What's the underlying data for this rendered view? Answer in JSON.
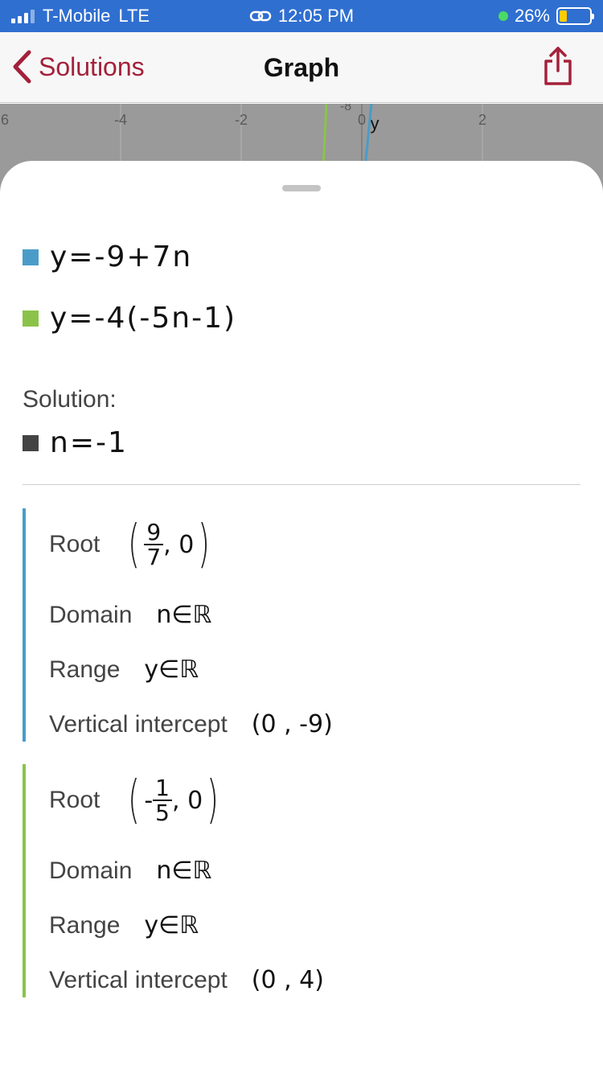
{
  "status_bar": {
    "carrier": "T-Mobile",
    "network": "LTE",
    "time": "12:05 PM",
    "battery_percent": "26%",
    "battery_level": 0.26,
    "icons": [
      "signal-icon",
      "link-icon",
      "location-dot-icon",
      "battery-icon"
    ]
  },
  "nav": {
    "back_label": "Solutions",
    "title": "Graph",
    "share_icon": "share-icon"
  },
  "graph_preview": {
    "x_ticks": [
      "6",
      "-4",
      "-2",
      "0",
      "2"
    ],
    "y_tick": "-8",
    "y_axis_label": "y"
  },
  "equations": [
    {
      "text": "y=-9+7n",
      "color": "#4a9cc8"
    },
    {
      "text": "y=-4(-5n-1)",
      "color": "#8bc34a"
    }
  ],
  "solution": {
    "label": "Solution:",
    "value": "n=-1",
    "color": "#444444"
  },
  "properties": [
    {
      "color": "#4a9cc8",
      "root_label": "Root",
      "root_sign": "",
      "root_num": "9",
      "root_den": "7",
      "root_y": ", 0",
      "domain_label": "Domain",
      "domain_value": "n∈ℝ",
      "range_label": "Range",
      "range_value": "y∈ℝ",
      "intercept_label": "Vertical intercept",
      "intercept_value": "(0 , -9)"
    },
    {
      "color": "#8bc34a",
      "root_label": "Root",
      "root_sign": "-",
      "root_num": "1",
      "root_den": "5",
      "root_y": ", 0",
      "domain_label": "Domain",
      "domain_value": "n∈ℝ",
      "range_label": "Range",
      "range_value": "y∈ℝ",
      "intercept_label": "Vertical intercept",
      "intercept_value": "(0 , 4)"
    }
  ]
}
